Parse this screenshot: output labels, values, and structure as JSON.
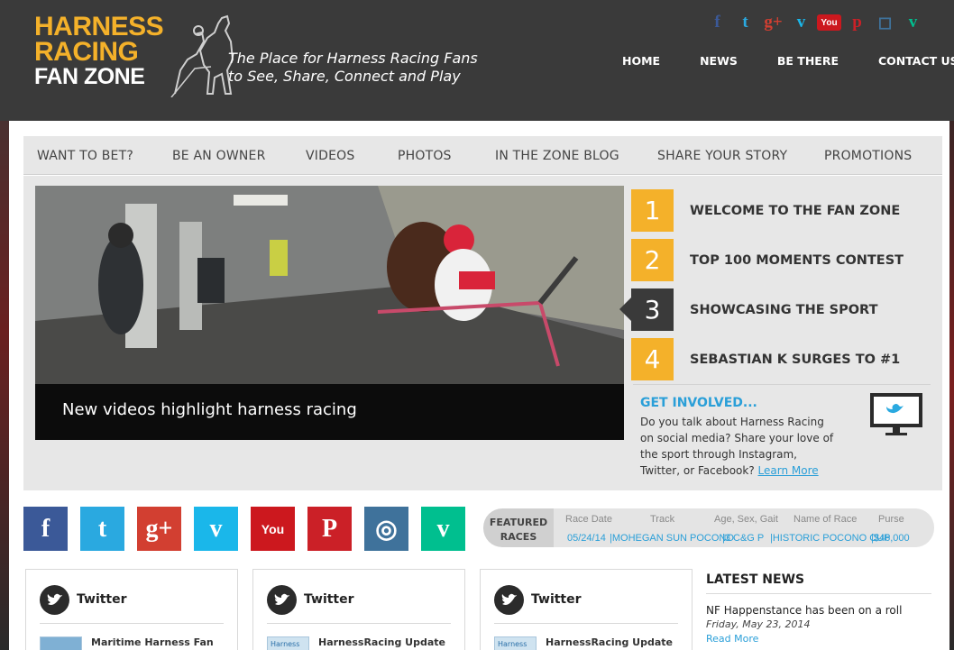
{
  "header": {
    "logo": {
      "line1": "HARNESS",
      "line2": "RACING",
      "line3": "FAN ZONE"
    },
    "tagline": {
      "line1": "The Place for Harness Racing Fans",
      "line2": "to See, Share, Connect and Play"
    },
    "social_icons": [
      {
        "name": "facebook-icon",
        "glyph": "f",
        "color": "#3b5998"
      },
      {
        "name": "twitter-icon",
        "glyph": "t",
        "color": "#2aa9e0"
      },
      {
        "name": "googleplus-icon",
        "glyph": "g+",
        "color": "#d23f31"
      },
      {
        "name": "vimeo-icon",
        "glyph": "v",
        "color": "#1ab7ea"
      },
      {
        "name": "youtube-icon",
        "glyph": "You",
        "color": "#cc181e"
      },
      {
        "name": "pinterest-icon",
        "glyph": "p",
        "color": "#cb2027"
      },
      {
        "name": "instagram-icon",
        "glyph": "◻",
        "color": "#3f729b"
      },
      {
        "name": "vine-icon",
        "glyph": "v",
        "color": "#00bf8f"
      }
    ],
    "nav": [
      {
        "label": "HOME"
      },
      {
        "label": "NEWS"
      },
      {
        "label": "BE THERE"
      },
      {
        "label": "CONTACT US"
      }
    ]
  },
  "subnav": [
    {
      "label": "WANT TO BET?"
    },
    {
      "label": "BE AN OWNER"
    },
    {
      "label": "VIDEOS"
    },
    {
      "label": "PHOTOS"
    },
    {
      "label": "IN THE ZONE BLOG"
    },
    {
      "label": "SHARE YOUR STORY"
    },
    {
      "label": "PROMOTIONS"
    }
  ],
  "hero": {
    "caption": "New videos highlight harness racing"
  },
  "slides": [
    {
      "num": "1",
      "title": "WELCOME TO THE FAN ZONE"
    },
    {
      "num": "2",
      "title": "TOP 100 MOMENTS CONTEST"
    },
    {
      "num": "3",
      "title": "SHOWCASING THE SPORT"
    },
    {
      "num": "4",
      "title": "SEBASTIAN K SURGES TO #1"
    }
  ],
  "involved": {
    "title": "GET INVOLVED...",
    "text": "Do you talk about Harness Racing on social media? Share your love of the sport through Instagram, Twitter, or Facebook?",
    "link": "Learn More"
  },
  "tiles": [
    {
      "name": "facebook-tile",
      "glyph": "f",
      "color": "#3b5998"
    },
    {
      "name": "twitter-tile",
      "glyph": "t",
      "color": "#2aa9e0"
    },
    {
      "name": "googleplus-tile",
      "glyph": "g+",
      "color": "#d23f31"
    },
    {
      "name": "vimeo-tile",
      "glyph": "v",
      "color": "#1ab7ea"
    },
    {
      "name": "youtube-tile",
      "glyph": "You",
      "color": "#cc181e"
    },
    {
      "name": "pinterest-tile",
      "glyph": "P",
      "color": "#cb2027"
    },
    {
      "name": "instagram-tile",
      "glyph": "◎",
      "color": "#3f729b"
    },
    {
      "name": "vine-tile",
      "glyph": "v",
      "color": "#00bf8f"
    }
  ],
  "featured": {
    "label_line1": "FEATURED",
    "label_line2": "RACES",
    "headers": [
      "Race Date",
      "Track",
      "Age, Sex, Gait",
      "Name of Race",
      "Purse"
    ],
    "row": [
      "05/24/14",
      "|MOHEGAN SUN POCONO",
      "|3 C&G P",
      "|HISTORIC POCONO CUP",
      "|$46,000"
    ]
  },
  "cards": [
    {
      "title": "Twitter",
      "item": "Maritime Harness Fan",
      "thumb": ""
    },
    {
      "title": "Twitter",
      "item": "HarnessRacing Update",
      "thumb": "Harness"
    },
    {
      "title": "Twitter",
      "item": "HarnessRacing Update",
      "thumb": "Harness"
    }
  ],
  "news": {
    "title": "LATEST NEWS",
    "item_title": "NF Happenstance has been on a roll",
    "item_date": "Friday, May 23, 2014",
    "read_more": "Read More"
  },
  "colors": {
    "accent": "#f4b12a",
    "dark": "#3a3a3a",
    "link": "#2a9fd8"
  }
}
